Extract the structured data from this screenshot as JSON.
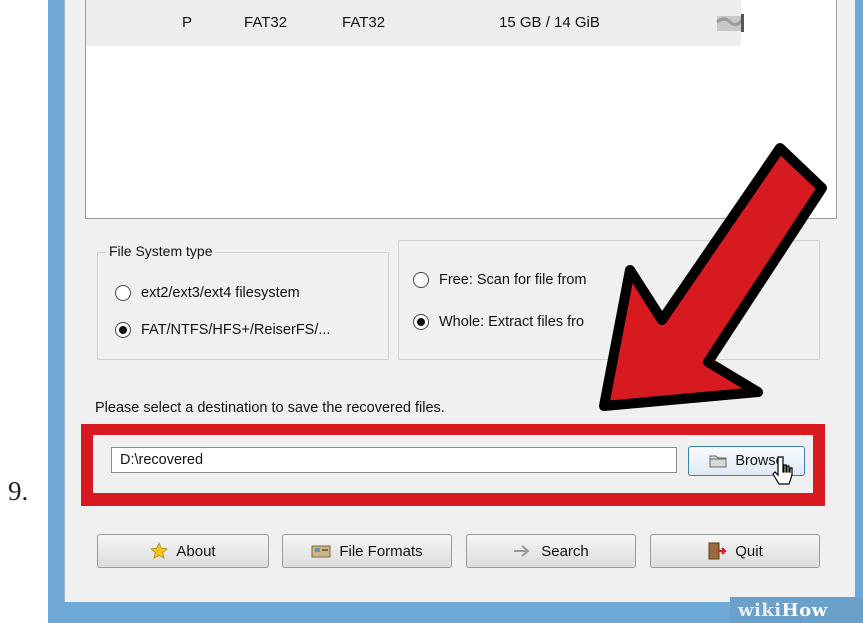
{
  "step_number": "9.",
  "partition": {
    "type": "P",
    "filesystem": "FAT32",
    "label": "FAT32",
    "size": "15 GB / 14 GiB"
  },
  "filesystem_group": {
    "title": "File System type",
    "options": [
      {
        "label": "ext2/ext3/ext4 filesystem",
        "checked": false
      },
      {
        "label": "FAT/NTFS/HFS+/ReiserFS/...",
        "checked": true
      }
    ]
  },
  "scan_group": {
    "options": [
      {
        "label": "Free: Scan for file from",
        "checked": false
      },
      {
        "label": "Whole: Extract files fro",
        "checked": true
      }
    ]
  },
  "destination": {
    "label": "Please select a destination to save the recovered files.",
    "path": "D:\\recovered",
    "browse_label": "Browse"
  },
  "buttons": {
    "about": "About",
    "file_formats": "File Formats",
    "search": "Search",
    "quit": "Quit"
  },
  "watermark": {
    "part1": "wiki",
    "part2": "How"
  },
  "colors": {
    "highlight_red": "#d71a1f",
    "window_frame": "#6fa9d8",
    "dialog_bg": "#f0f0f0"
  }
}
